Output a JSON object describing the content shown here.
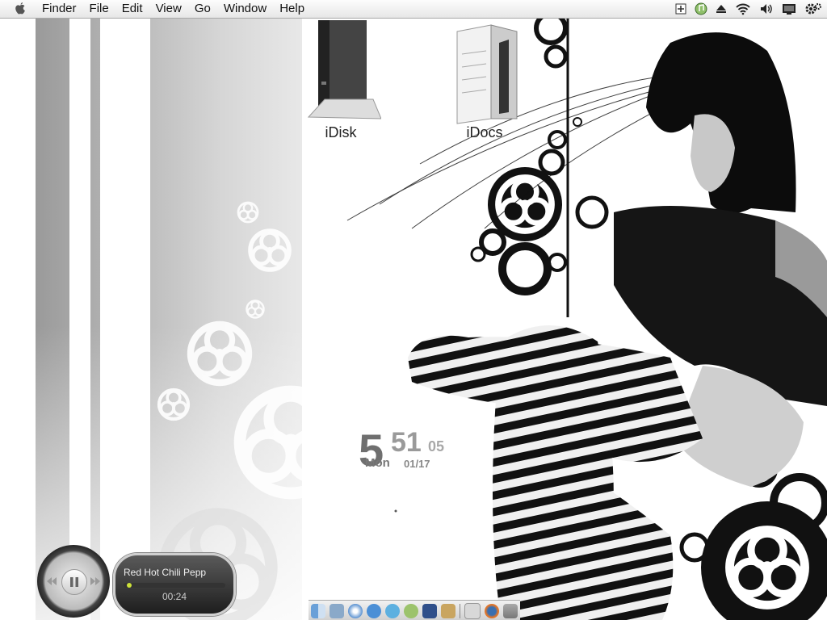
{
  "menubar": {
    "items": [
      "Finder",
      "File",
      "Edit",
      "View",
      "Go",
      "Window",
      "Help"
    ]
  },
  "status_icons": [
    "add-item-icon",
    "itunes-icon",
    "eject-icon",
    "wifi-icon",
    "volume-icon",
    "display-icon",
    "gear-icon"
  ],
  "desktop_icons": [
    {
      "label": "iDisk",
      "icon": "idisk-icon"
    },
    {
      "label": "iDocs",
      "icon": "folder-icon"
    }
  ],
  "clock": {
    "hour": "5",
    "minute": "51",
    "second": "05",
    "day": "Mon",
    "date": "01/17"
  },
  "player": {
    "track": "Red Hot Chili Pepp",
    "time": "00:24",
    "progress": 0.03
  },
  "dock": {
    "apps": [
      "finder-icon",
      "mail-icon",
      "safari-icon",
      "ical-icon",
      "ichat-icon",
      "itunes-icon",
      "imovie-icon",
      "addressbook-icon",
      "preview-icon",
      "firefox-icon",
      "trash-icon"
    ]
  }
}
